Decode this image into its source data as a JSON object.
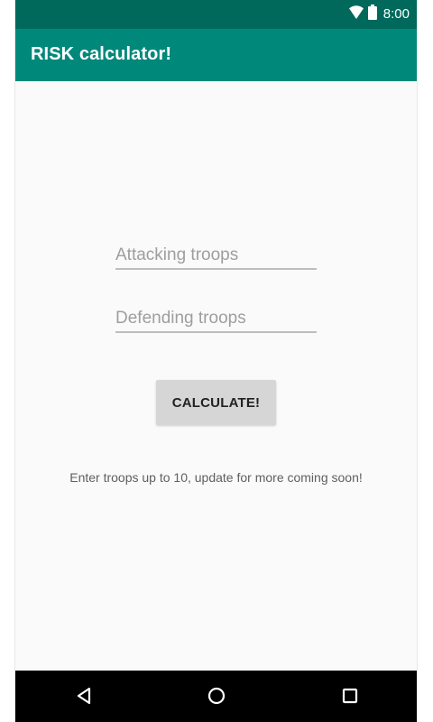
{
  "status_bar": {
    "time": "8:00",
    "icons": [
      "wifi-icon",
      "battery-icon"
    ],
    "background": "#00695c",
    "icon_color": "#ffffff"
  },
  "app_bar": {
    "title": "RISK calculator!",
    "background": "#00897b"
  },
  "form": {
    "attacking_troops": {
      "placeholder": "Attacking troops",
      "value": ""
    },
    "defending_troops": {
      "placeholder": "Defending troops",
      "value": ""
    },
    "calculate_button": {
      "label": "CALCULATE!"
    }
  },
  "message": {
    "text": "Enter troops up to 10, update for more coming soon!"
  },
  "navigation_bar": {
    "icons": [
      "back-icon",
      "home-icon",
      "overview-icon"
    ],
    "background": "#000000"
  }
}
